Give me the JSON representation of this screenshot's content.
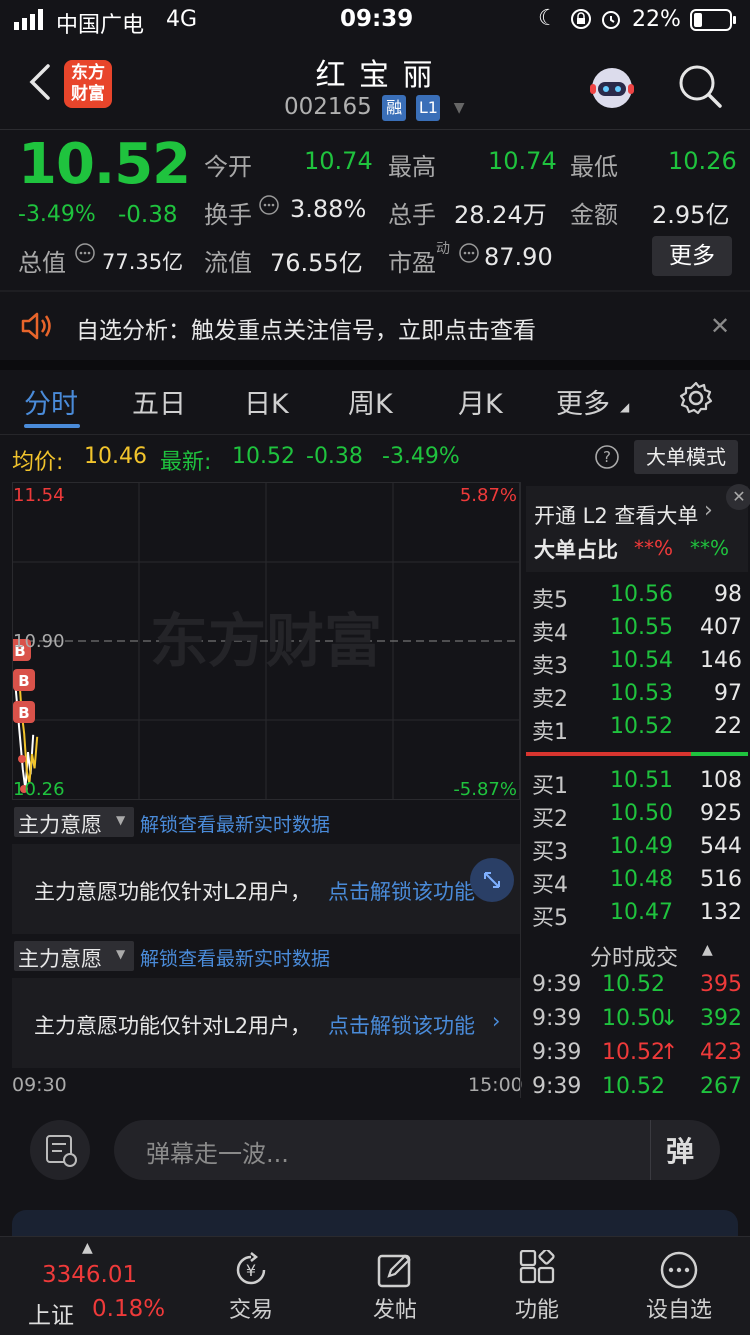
{
  "status": {
    "carrier": "中国广电",
    "network": "4G",
    "time": "09:39",
    "battery": "22%"
  },
  "header": {
    "title": "红 宝 丽",
    "code": "002165",
    "tag_margin": "融",
    "tag_level": "L1",
    "logo_line1": "东方",
    "logo_line2": "财富"
  },
  "quote": {
    "price": "10.52",
    "pct": "-3.49%",
    "change": "-0.38",
    "open_label": "今开",
    "open": "10.74",
    "high_label": "最高",
    "high": "10.74",
    "low_label": "最低",
    "low": "10.26",
    "turnover_label": "换手",
    "turnover": "3.88%",
    "volume_label": "总手",
    "volume": "28.24万",
    "amount_label": "金额",
    "amount": "2.95亿",
    "mcap_label": "总值",
    "mcap": "77.35亿",
    "float_label": "流值",
    "float": "76.55亿",
    "pe_label": "市盈",
    "pe_sup": "动",
    "pe": "87.90",
    "more_button": "更多"
  },
  "notice": {
    "text": "自选分析：触发重点关注信号，立即点击查看"
  },
  "tabs": [
    {
      "label": "分时",
      "active": true
    },
    {
      "label": "五日",
      "active": false
    },
    {
      "label": "日K",
      "active": false
    },
    {
      "label": "周K",
      "active": false
    },
    {
      "label": "月K",
      "active": false
    },
    {
      "label": "更多",
      "active": false
    }
  ],
  "infobar": {
    "avg_label": "均价:",
    "avg": "10.46",
    "latest_label": "最新:",
    "latest": "10.52",
    "change": "-0.38",
    "pct": "-3.49%",
    "mode_button": "大单模式"
  },
  "chart_data": {
    "type": "line",
    "y_top": "11.54",
    "y_mid": "10.90",
    "y_bottom": "10.26",
    "pct_top": "5.87%",
    "pct_bottom": "-5.87%",
    "x_start": "09:30",
    "x_end": "15:00",
    "watermark": "东方财富",
    "markers": [
      "B",
      "B",
      "B"
    ],
    "series": [
      {
        "values": [
          10.74,
          10.62,
          10.5,
          10.38,
          10.3,
          10.45,
          10.36,
          10.52
        ]
      }
    ],
    "ylim": [
      10.26,
      11.54
    ]
  },
  "panels": [
    {
      "dropdown": "主力意愿",
      "unlock_link": "解锁查看最新实时数据",
      "message": "主力意愿功能仅针对L2用户，",
      "action": "点击解锁该功能"
    },
    {
      "dropdown": "主力意愿",
      "unlock_link": "解锁查看最新实时数据",
      "message": "主力意愿功能仅针对L2用户，",
      "action": "点击解锁该功能"
    }
  ],
  "orderbook": {
    "l2_text": "开通 L2 查看大单",
    "ratio_label": "大单占比",
    "ratio_red": "**%",
    "ratio_green": "**%",
    "asks": [
      {
        "label": "卖5",
        "price": "10.56",
        "vol": "98"
      },
      {
        "label": "卖4",
        "price": "10.55",
        "vol": "407"
      },
      {
        "label": "卖3",
        "price": "10.54",
        "vol": "146"
      },
      {
        "label": "卖2",
        "price": "10.53",
        "vol": "97"
      },
      {
        "label": "卖1",
        "price": "10.52",
        "vol": "22"
      }
    ],
    "bids": [
      {
        "label": "买1",
        "price": "10.51",
        "vol": "108"
      },
      {
        "label": "买2",
        "price": "10.50",
        "vol": "925"
      },
      {
        "label": "买3",
        "price": "10.49",
        "vol": "544"
      },
      {
        "label": "买4",
        "price": "10.48",
        "vol": "516"
      },
      {
        "label": "买5",
        "price": "10.47",
        "vol": "132"
      }
    ],
    "trades_title": "分时成交",
    "trades": [
      {
        "time": "9:39",
        "price": "10.52",
        "arrow": "",
        "vol": "395"
      },
      {
        "time": "9:39",
        "price": "10.50",
        "arrow": "↓",
        "vol": "392"
      },
      {
        "time": "9:39",
        "price": "10.52",
        "arrow": "↑",
        "vol": "423"
      },
      {
        "time": "9:39",
        "price": "10.52",
        "arrow": "",
        "vol": "267"
      }
    ]
  },
  "danmu": {
    "placeholder": "弹幕走一波...",
    "send_glyph": "弹"
  },
  "index": {
    "value": "3346.01",
    "name": "上证",
    "pct": "0.18%"
  },
  "bottom_nav": [
    {
      "label": "交易",
      "icon": "yen-refresh-icon"
    },
    {
      "label": "发帖",
      "icon": "edit-icon"
    },
    {
      "label": "功能",
      "icon": "grid-icon"
    },
    {
      "label": "设自选",
      "icon": "more-circle-icon"
    }
  ],
  "colors": {
    "up": "#ee3a3a",
    "down": "#1fc33e",
    "accent": "#4a8bd9",
    "avg": "#f2c42c",
    "background": "#141418"
  }
}
